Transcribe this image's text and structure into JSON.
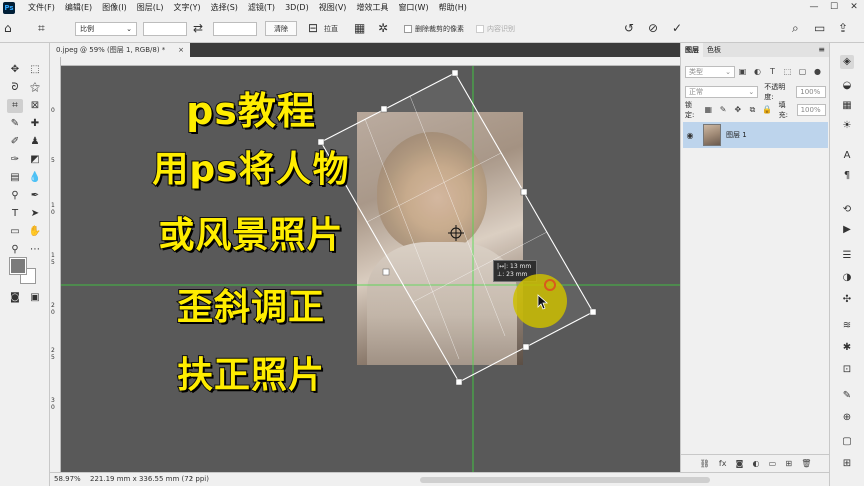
{
  "app": {
    "logo": "Ps"
  },
  "menu": [
    "文件(F)",
    "编辑(E)",
    "图像(I)",
    "图层(L)",
    "文字(Y)",
    "选择(S)",
    "滤镜(T)",
    "3D(D)",
    "视图(V)",
    "增效工具",
    "窗口(W)",
    "帮助(H)"
  ],
  "window_controls": {
    "minimize": "—",
    "maximize": "☐",
    "close": "✕"
  },
  "options": {
    "ratio_label": "比例",
    "clear_label": "清除",
    "straighten_label": "拉直",
    "delete_cropped_label": "删除裁剪的像素",
    "content_aware_label": "内容识别"
  },
  "document_tab": {
    "title": "0.jpeg @ 59% (图层 1, RGB/8) *",
    "close": "×"
  },
  "ruler_ticks": [
    "0",
    "5",
    "1 0",
    "1 5",
    "2 0",
    "2 5",
    "3 0"
  ],
  "overlay": {
    "lines": [
      "ps教程",
      "用ps将人物",
      "或风景照片",
      "歪斜调正",
      "扶正照片"
    ],
    "color": "#ffed00"
  },
  "measure_tooltip": {
    "w": "|↔|: 13 mm",
    "h": "⊥: 23 mm"
  },
  "status": {
    "zoom": "58.97%",
    "doc_info": "221.19 mm x 336.55 mm (72 ppi)",
    "arrow": "›"
  },
  "layers_panel": {
    "tabs": [
      "图层",
      "色板"
    ],
    "kind_placeholder": "类型",
    "blend_mode": "正常",
    "opacity_label": "不透明度:",
    "opacity_value": "100%",
    "lock_label": "锁定:",
    "fill_label": "填充:",
    "fill_value": "100%",
    "layers": [
      {
        "name": "图层 1",
        "visible": true,
        "selected": true
      }
    ]
  },
  "colors": {
    "accent_selected": "#bdd4ec",
    "canvas": "#595959",
    "highlight": "#cdbe00"
  }
}
